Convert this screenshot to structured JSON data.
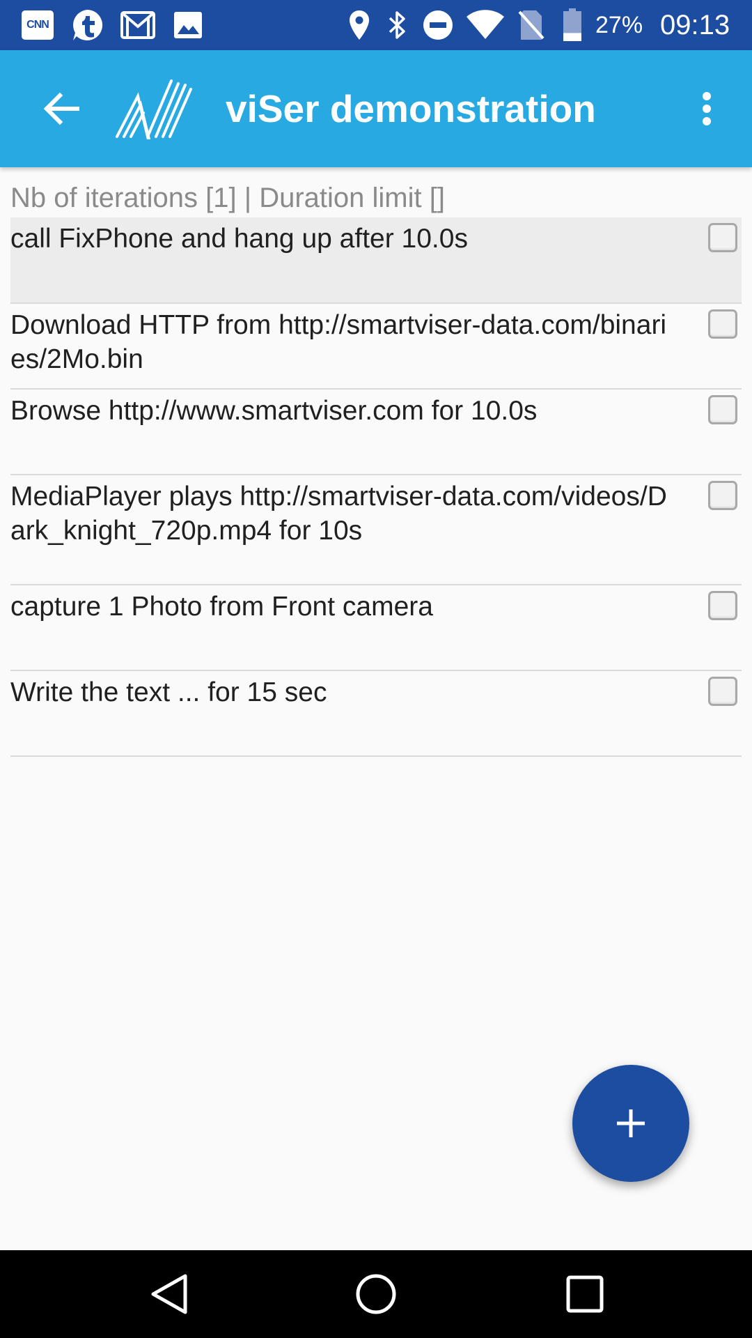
{
  "status_bar": {
    "notification_icons": [
      "cnn-icon",
      "tumblr-icon",
      "gmail-icon",
      "image-icon"
    ],
    "cnn_label": "CNN",
    "system_icons": [
      "location-icon",
      "bluetooth-icon",
      "do-not-disturb-icon",
      "wifi-icon",
      "no-sim-icon",
      "battery-icon"
    ],
    "battery_level": 0.27,
    "battery_text": "27%",
    "time": "09:13"
  },
  "app_bar": {
    "back_icon": "arrow-back-icon",
    "logo_icon": "viser-logo-icon",
    "title": "viSer demonstration",
    "overflow_icon": "more-vert-icon"
  },
  "summary": "Nb of iterations [1] | Duration limit []",
  "tasks": [
    {
      "text": "call FixPhone and hang up after 10.0s",
      "checked": false,
      "selected": true
    },
    {
      "text": "Download HTTP  from http://smartviser-data.com/binaries/2Mo.bin",
      "checked": false,
      "selected": false
    },
    {
      "text": "Browse http://www.smartviser.com for 10.0s",
      "checked": false,
      "selected": false
    },
    {
      "text": "MediaPlayer plays http://smartviser-data.com/videos/Dark_knight_720p.mp4 for 10s",
      "checked": false,
      "selected": false
    },
    {
      "text": "capture 1 Photo from Front camera",
      "checked": false,
      "selected": false
    },
    {
      "text": "Write the text ... for 15 sec",
      "checked": false,
      "selected": false
    }
  ],
  "fab": {
    "icon": "add-icon"
  },
  "nav_bar": {
    "back_icon": "nav-back-icon",
    "home_icon": "nav-home-icon",
    "recents_icon": "nav-recents-icon"
  },
  "colors": {
    "status_bar": "#1d4da1",
    "app_bar": "#29a9e1",
    "fab": "#1d4da1",
    "background": "#fafafa",
    "selected_row": "#ececec"
  }
}
